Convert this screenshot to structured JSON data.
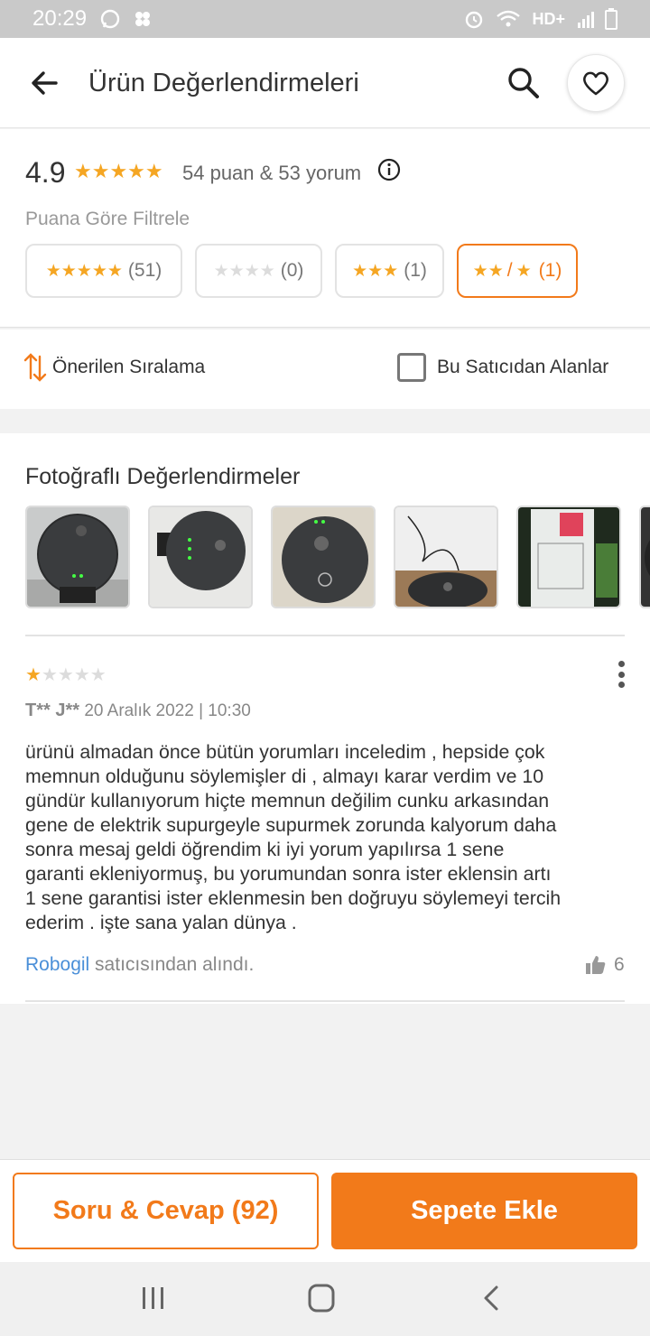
{
  "status_bar": {
    "time": "20:29",
    "network": "HD+"
  },
  "header": {
    "title": "Ürün Değerlendirmeleri",
    "icons": [
      "arrow-left-icon",
      "search-icon",
      "heart-icon"
    ]
  },
  "summary": {
    "score": "4.9",
    "stars": "★★★★★",
    "counts": "54 puan & 53 yorum",
    "filter_label": "Puana Göre Filtrele",
    "filters": [
      {
        "stars": "★★★★★",
        "count": "(51)",
        "active": false
      },
      {
        "stars": "★★★★",
        "count": "(0)",
        "active": false
      },
      {
        "stars": "★★★",
        "count": "(1)",
        "active": false
      },
      {
        "stars_a": "★★",
        "sep": "/",
        "stars_b": "★",
        "count": "(1)",
        "active": true
      }
    ]
  },
  "sort": {
    "label": "Önerilen Sıralama",
    "seller_filter_label": "Bu Satıcıdan Alanlar",
    "seller_filter_checked": false
  },
  "photos": {
    "title": "Fotoğraflı Değerlendirmeler",
    "count_visible": 6
  },
  "review": {
    "rating": 1,
    "max_rating": 5,
    "author": "T** J**",
    "date": "20 Aralık 2022 | 10:30",
    "text": "ürünü almadan  önce bütün yorumları inceledim , hepside çok\nmemnun olduğunu söylemişler di , almayı karar verdim ve 10\ngündür kullanıyorum hiçte memnun değilim   cunku  arkasından\ngene de elektrik supurgeyle supurmek zorunda kalyorum daha\nsonra mesaj geldi  öğrendim ki  iyi yorum yapılırsa 1 sene\ngaranti ekleniyormuş, bu yorumundan sonra ister eklensin artı\n1 sene garantisi ister eklenmesin ben doğruyu söylemeyi tercih\nederim . işte  sana yalan dünya .",
    "seller_name": "Robogil",
    "seller_suffix": " satıcısından alındı.",
    "likes": "6"
  },
  "actions": {
    "qa_label": "Soru & Cevap (92)",
    "cart_label": "Sepete Ekle"
  },
  "colors": {
    "accent": "#f27a1a",
    "star": "#f5a623",
    "link": "#4a8fd8"
  }
}
